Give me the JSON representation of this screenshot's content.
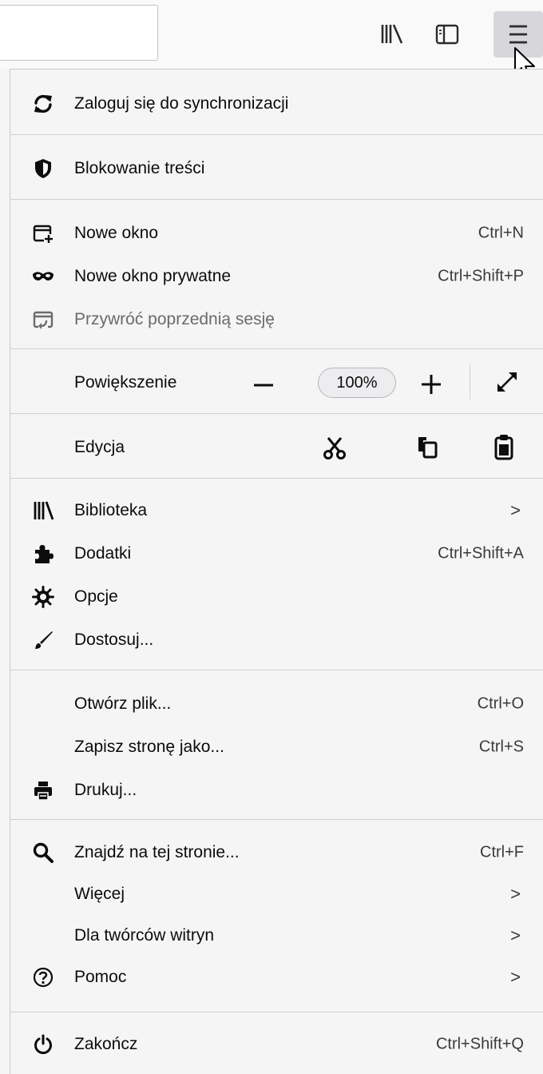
{
  "menu": {
    "sync": {
      "label": "Zaloguj się do synchronizacji"
    },
    "content_blocking": {
      "label": "Blokowanie treści"
    },
    "new_window": {
      "label": "Nowe okno",
      "shortcut": "Ctrl+N"
    },
    "new_private_window": {
      "label": "Nowe okno prywatne",
      "shortcut": "Ctrl+Shift+P"
    },
    "restore_session": {
      "label": "Przywróć poprzednią sesję"
    },
    "zoom": {
      "label": "Powiększenie",
      "minus": "−",
      "value": "100%",
      "plus": "+"
    },
    "edit": {
      "label": "Edycja"
    },
    "library": {
      "label": "Biblioteka",
      "arrow": ">"
    },
    "addons": {
      "label": "Dodatki",
      "shortcut": "Ctrl+Shift+A"
    },
    "options": {
      "label": "Opcje"
    },
    "customize": {
      "label": "Dostosuj..."
    },
    "open_file": {
      "label": "Otwórz plik...",
      "shortcut": "Ctrl+O"
    },
    "save_page": {
      "label": "Zapisz stronę jako...",
      "shortcut": "Ctrl+S"
    },
    "print": {
      "label": "Drukuj..."
    },
    "find": {
      "label": "Znajdź na tej stronie...",
      "shortcut": "Ctrl+F"
    },
    "more": {
      "label": "Więcej",
      "arrow": ">"
    },
    "web_developer": {
      "label": "Dla twórców witryn",
      "arrow": ">"
    },
    "help": {
      "label": "Pomoc",
      "arrow": ">"
    },
    "quit": {
      "label": "Zakończ",
      "shortcut": "Ctrl+Shift+Q"
    }
  },
  "icons": {
    "sync": "sync-icon",
    "content_blocking": "shield-icon",
    "new_window": "new-window-icon",
    "private": "mask-icon",
    "restore": "restore-session-icon",
    "library": "library-icon",
    "addons": "puzzle-icon",
    "options": "gear-icon",
    "customize": "paintbrush-icon",
    "print": "printer-icon",
    "find": "search-icon",
    "help": "help-icon",
    "quit": "power-icon"
  },
  "colors": {
    "panel_bg": "#f5f5f6",
    "text": "#0c0c0d",
    "separator": "#d0d0d4",
    "menu_button_active": "#d7d7db"
  }
}
